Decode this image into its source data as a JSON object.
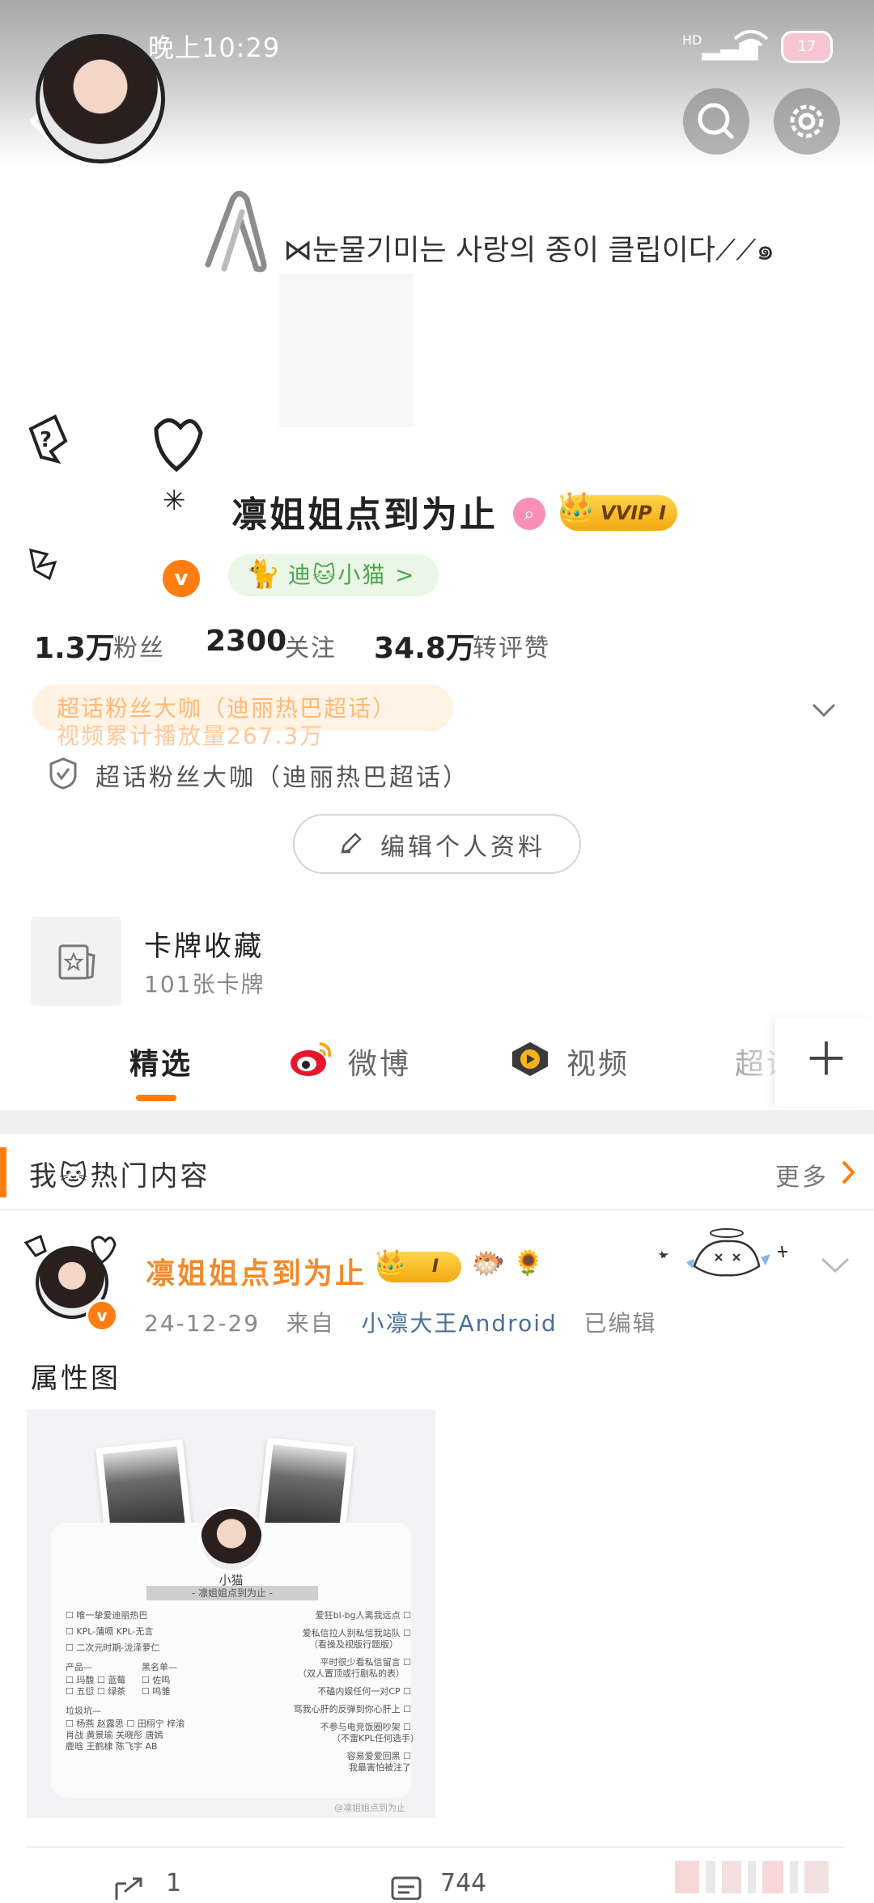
{
  "status_bar": {
    "time": "晚上10:29",
    "network": "HD",
    "battery": "17"
  },
  "banner": {
    "text": "⋈눈물기미는 사랑의 종이 클립이다⟋⟋๑"
  },
  "profile": {
    "username": "凛姐姐点到为止",
    "vip_label": "VVIP I",
    "group_pill": "迪🐱小猫 >",
    "verify_mark": "v",
    "stats": [
      {
        "value": "1.3万",
        "label": "粉丝"
      },
      {
        "value": "2300",
        "label": "关注"
      },
      {
        "value": "34.8万",
        "label": "转评赞"
      }
    ],
    "tag_lines": [
      "超话粉丝大咖（迪丽热巴超话）",
      "视频累计播放量267.3万"
    ],
    "super_fan": "超话粉丝大咖（迪丽热巴超话）",
    "edit_button": "编辑个人资料"
  },
  "card_collection": {
    "title": "卡牌收藏",
    "subtitle": "101张卡牌"
  },
  "tabs": [
    {
      "label": "精选"
    },
    {
      "label": "微博"
    },
    {
      "label": "视频"
    },
    {
      "label": "超话"
    }
  ],
  "hot_section": {
    "title": "我🐱热门内容",
    "more": "更多"
  },
  "post": {
    "author": "凛姐姐点到为止",
    "badge": "I",
    "date": "24-12-29",
    "from": "来自",
    "source": "小凛大王Android",
    "edited": "已编辑",
    "text": "属性图",
    "share_count": "1",
    "comment_count": "744",
    "image": {
      "name": "小猫",
      "handle": "- 凛姐姐点到为止 -",
      "left_items": [
        "☐ 唯一挚爱迪丽热巴",
        "☐ KPL-蒲嗝  KPL-无言",
        "☐ 二次元时期-泷泽萝仁"
      ],
      "products_label": "产品—",
      "blacklist_label": "黑名单—",
      "products": [
        "☐ 玛馥  ☐ 蓝莓",
        "☐ 五愆  ☐ 绿茶"
      ],
      "blacklist": [
        "☐ 佐鸣",
        "☐ 鸣雏"
      ],
      "boys_label": "垃圾坑—",
      "boys": [
        "☐ 杨燕  赵露思  ☐ 田栩宁  梓渝",
        "   肖战  黄景瑜     关晓彤  唐嫣",
        "   鹿晗  王鹤棣     陈飞宇  AB"
      ],
      "right_items": [
        "爱狂bl-bg人离我远点 ☐",
        "爱私信拉人别私信我站队 ☐",
        "（看操及视版行题版）",
        "平时很少看私信留言 ☐",
        "（双人置顶或行剧私的表）",
        "不磕内娱任何一对CP ☐",
        "骂我心肝的反弹到你心肝上 ☐",
        "不参与电竞饭圈吵架 ☐",
        "（不雷KPL任何选手）",
        "容易爱爱回黑 ☐",
        "我最害怕被注了"
      ],
      "watermark": "@凛姐姐点到为止"
    }
  },
  "colors": {
    "accent": "#ff7d13",
    "vip_gold": "#f3a813",
    "author_orange": "#f08a2a",
    "source_blue": "#4a6e9a",
    "group_green": "#4ea54e"
  },
  "icons": [
    "back-arrow-icon",
    "search-icon",
    "gear-icon",
    "paperclip-icon",
    "chevron-down-icon",
    "shield-icon",
    "pencil-icon",
    "card-icon",
    "weibo-icon",
    "video-icon",
    "plus-icon",
    "chevron-right-icon",
    "share-icon",
    "comment-icon"
  ]
}
